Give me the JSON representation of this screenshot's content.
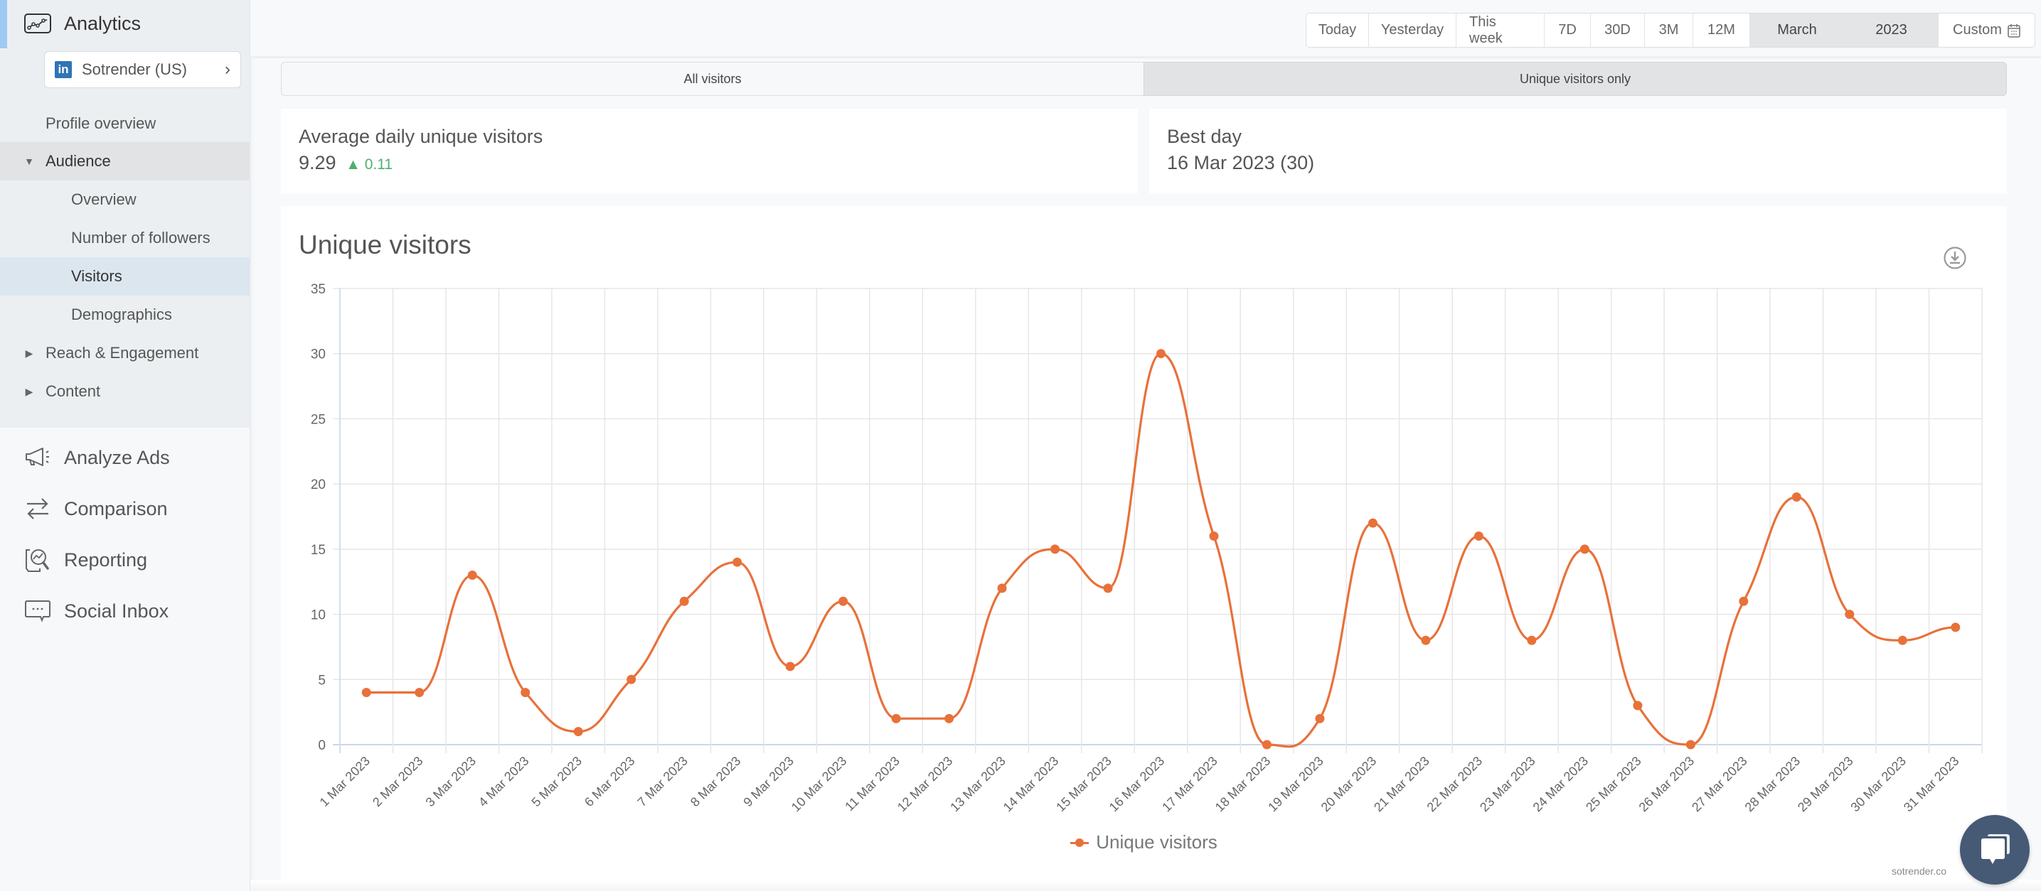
{
  "sidebar": {
    "app_title": "Analytics",
    "account": {
      "network": "in",
      "name": "Sotrender (US)"
    },
    "profile_overview": "Profile overview",
    "audience": {
      "label": "Audience",
      "items": [
        {
          "label": "Overview",
          "selected": false
        },
        {
          "label": "Number of followers",
          "selected": false
        },
        {
          "label": "Visitors",
          "selected": true
        },
        {
          "label": "Demographics",
          "selected": false
        }
      ]
    },
    "groups": [
      {
        "label": "Reach & Engagement"
      },
      {
        "label": "Content"
      }
    ],
    "main_nav": [
      {
        "label": "Analyze Ads",
        "icon": "megaphone-icon"
      },
      {
        "label": "Comparison",
        "icon": "swap-arrows-icon"
      },
      {
        "label": "Reporting",
        "icon": "report-search-icon"
      },
      {
        "label": "Social Inbox",
        "icon": "chat-bubble-icon"
      }
    ]
  },
  "header": {
    "date_range": [
      {
        "label": "Today",
        "active": false
      },
      {
        "label": "Yesterday",
        "active": false
      },
      {
        "label": "This week",
        "active": false
      },
      {
        "label": "7D",
        "active": false
      },
      {
        "label": "30D",
        "active": false
      },
      {
        "label": "3M",
        "active": false
      },
      {
        "label": "12M",
        "active": false
      },
      {
        "label": "March",
        "active": true
      },
      {
        "label": "2023",
        "active": true
      },
      {
        "label": "Custom",
        "active": false
      }
    ]
  },
  "tabs": [
    {
      "label": "All visitors",
      "active": false
    },
    {
      "label": "Unique visitors only",
      "active": true
    }
  ],
  "stats": {
    "avg": {
      "title": "Average daily unique visitors",
      "value": "9.29",
      "delta": "0.11",
      "delta_direction": "up"
    },
    "best": {
      "title": "Best day",
      "value": "16 Mar 2023 (30)"
    }
  },
  "chart_card": {
    "title": "Unique visitors",
    "credit": "sotrender.co"
  },
  "colors": {
    "series": "#e8713a",
    "delta_up": "#4caf6e",
    "accent": "#9ec9f3",
    "chat": "#465a75"
  },
  "chart_data": {
    "type": "line",
    "title": "Unique visitors",
    "xlabel": "",
    "ylabel": "",
    "ylim": [
      0,
      35
    ],
    "yticks": [
      0,
      5,
      10,
      15,
      20,
      25,
      30,
      35
    ],
    "grid": true,
    "legend": "bottom-center",
    "categories": [
      "1 Mar 2023",
      "2 Mar 2023",
      "3 Mar 2023",
      "4 Mar 2023",
      "5 Mar 2023",
      "6 Mar 2023",
      "7 Mar 2023",
      "8 Mar 2023",
      "9 Mar 2023",
      "10 Mar 2023",
      "11 Mar 2023",
      "12 Mar 2023",
      "13 Mar 2023",
      "14 Mar 2023",
      "15 Mar 2023",
      "16 Mar 2023",
      "17 Mar 2023",
      "18 Mar 2023",
      "19 Mar 2023",
      "20 Mar 2023",
      "21 Mar 2023",
      "22 Mar 2023",
      "23 Mar 2023",
      "24 Mar 2023",
      "25 Mar 2023",
      "26 Mar 2023",
      "27 Mar 2023",
      "28 Mar 2023",
      "29 Mar 2023",
      "30 Mar 2023",
      "31 Mar 2023"
    ],
    "series": [
      {
        "name": "Unique visitors",
        "values": [
          4,
          4,
          13,
          4,
          1,
          5,
          11,
          14,
          6,
          11,
          2,
          2,
          12,
          15,
          12,
          30,
          16,
          0,
          2,
          17,
          8,
          16,
          8,
          15,
          3,
          0,
          11,
          19,
          10,
          8,
          9
        ]
      }
    ]
  }
}
